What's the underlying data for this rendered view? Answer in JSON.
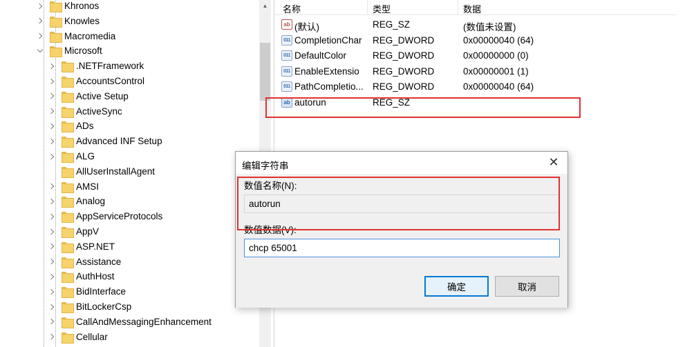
{
  "tree": {
    "items": [
      {
        "label": "Khronos",
        "level": 0,
        "state": "collapsed"
      },
      {
        "label": "Knowles",
        "level": 0,
        "state": "collapsed"
      },
      {
        "label": "Macromedia",
        "level": 0,
        "state": "collapsed"
      },
      {
        "label": "Microsoft",
        "level": 0,
        "state": "expanded"
      },
      {
        "label": ".NETFramework",
        "level": 1,
        "state": "collapsed"
      },
      {
        "label": "AccountsControl",
        "level": 1,
        "state": "collapsed"
      },
      {
        "label": "Active Setup",
        "level": 1,
        "state": "collapsed"
      },
      {
        "label": "ActiveSync",
        "level": 1,
        "state": "collapsed"
      },
      {
        "label": "ADs",
        "level": 1,
        "state": "collapsed"
      },
      {
        "label": "Advanced INF Setup",
        "level": 1,
        "state": "collapsed"
      },
      {
        "label": "ALG",
        "level": 1,
        "state": "collapsed"
      },
      {
        "label": "AllUserInstallAgent",
        "level": 1,
        "state": "leaf"
      },
      {
        "label": "AMSI",
        "level": 1,
        "state": "collapsed"
      },
      {
        "label": "Analog",
        "level": 1,
        "state": "collapsed"
      },
      {
        "label": "AppServiceProtocols",
        "level": 1,
        "state": "collapsed"
      },
      {
        "label": "AppV",
        "level": 1,
        "state": "collapsed"
      },
      {
        "label": "ASP.NET",
        "level": 1,
        "state": "collapsed"
      },
      {
        "label": "Assistance",
        "level": 1,
        "state": "collapsed"
      },
      {
        "label": "AuthHost",
        "level": 1,
        "state": "collapsed"
      },
      {
        "label": "BidInterface",
        "level": 1,
        "state": "collapsed"
      },
      {
        "label": "BitLockerCsp",
        "level": 1,
        "state": "collapsed"
      },
      {
        "label": "CallAndMessagingEnhancement",
        "level": 1,
        "state": "collapsed"
      },
      {
        "label": "Cellular",
        "level": 1,
        "state": "collapsed"
      }
    ]
  },
  "list": {
    "headers": {
      "name": "名称",
      "type": "类型",
      "data": "数据"
    },
    "rows": [
      {
        "icon": "string-value-icon",
        "name": "(默认)",
        "type": "REG_SZ",
        "data": "(数值未设置)"
      },
      {
        "icon": "dword-value-icon",
        "name": "CompletionChar",
        "type": "REG_DWORD",
        "data": "0x00000040 (64)"
      },
      {
        "icon": "dword-value-icon",
        "name": "DefaultColor",
        "type": "REG_DWORD",
        "data": "0x00000000 (0)"
      },
      {
        "icon": "dword-value-icon",
        "name": "EnableExtensio",
        "type": "REG_DWORD",
        "data": "0x00000001 (1)"
      },
      {
        "icon": "dword-value-icon",
        "name": "PathCompletio...",
        "type": "REG_DWORD",
        "data": "0x00000040 (64)"
      },
      {
        "icon": "string-value-icon",
        "name": "autorun",
        "type": "REG_SZ",
        "data": ""
      }
    ]
  },
  "dialog": {
    "title": "编辑字符串",
    "close_glyph": "✕",
    "name_label": "数值名称(N):",
    "name_value": "autorun",
    "data_label": "数值数据(V):",
    "data_value": "chcp 65001",
    "ok_label": "确定",
    "cancel_label": "取消"
  },
  "colors": {
    "highlight": "#e03030",
    "accent": "#0078d7"
  }
}
